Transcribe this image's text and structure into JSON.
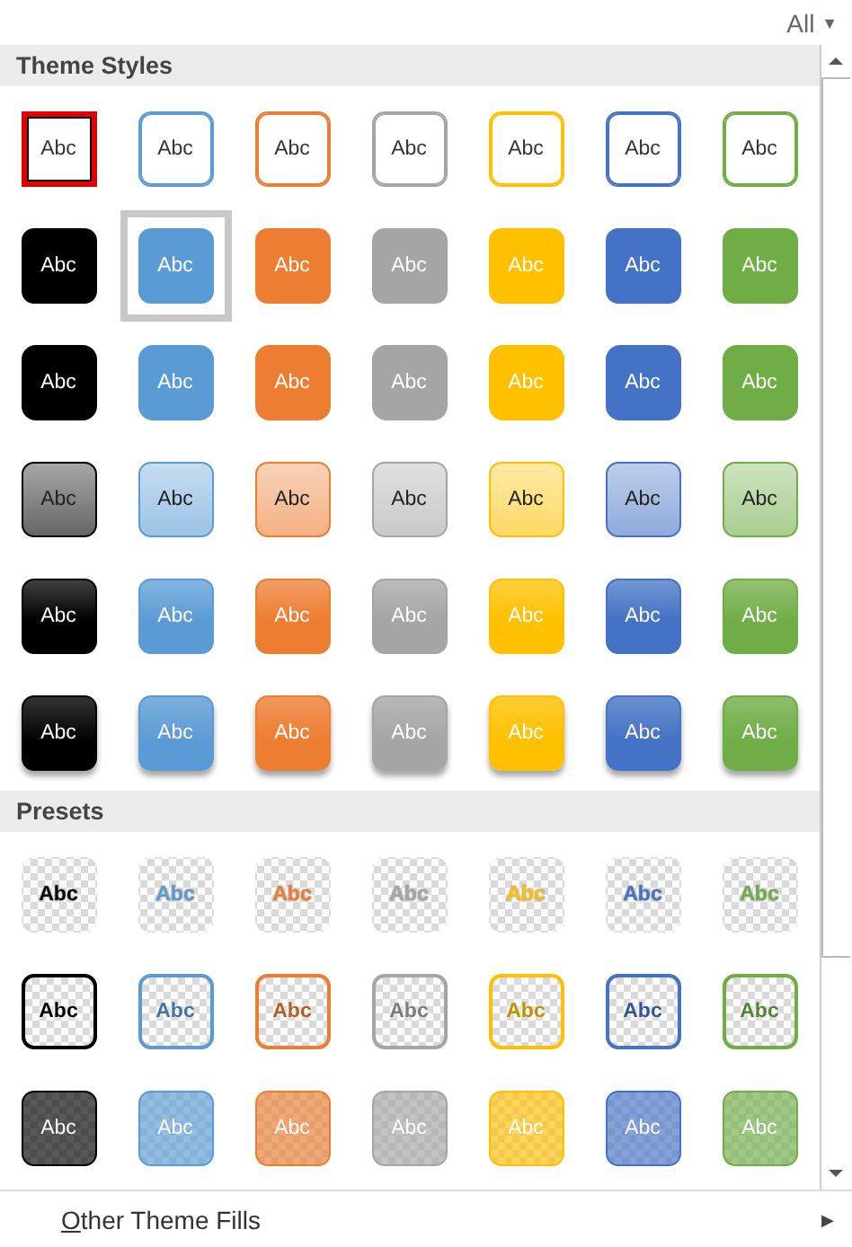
{
  "filter": {
    "label": "All",
    "caret": "▼"
  },
  "sections": [
    {
      "title": "Theme Styles",
      "rows": [
        {
          "kind": "outline",
          "items": [
            {
              "label": "Abc",
              "color": "#000000",
              "selected": true,
              "hovered": false
            },
            {
              "label": "Abc",
              "color": "#5b9bd5",
              "selected": false,
              "hovered": false
            },
            {
              "label": "Abc",
              "color": "#ed7d31",
              "selected": false,
              "hovered": false
            },
            {
              "label": "Abc",
              "color": "#a5a5a5",
              "selected": false,
              "hovered": false
            },
            {
              "label": "Abc",
              "color": "#ffc000",
              "selected": false,
              "hovered": false
            },
            {
              "label": "Abc",
              "color": "#4472c4",
              "selected": false,
              "hovered": false
            },
            {
              "label": "Abc",
              "color": "#70ad47",
              "selected": false,
              "hovered": false
            }
          ]
        },
        {
          "kind": "solid",
          "items": [
            {
              "label": "Abc",
              "color": "#000000",
              "selected": false,
              "hovered": false
            },
            {
              "label": "Abc",
              "color": "#5b9bd5",
              "selected": false,
              "hovered": true
            },
            {
              "label": "Abc",
              "color": "#ed7d31",
              "selected": false,
              "hovered": false
            },
            {
              "label": "Abc",
              "color": "#a5a5a5",
              "selected": false,
              "hovered": false
            },
            {
              "label": "Abc",
              "color": "#ffc000",
              "selected": false,
              "hovered": false
            },
            {
              "label": "Abc",
              "color": "#4472c4",
              "selected": false,
              "hovered": false
            },
            {
              "label": "Abc",
              "color": "#70ad47",
              "selected": false,
              "hovered": false
            }
          ]
        },
        {
          "kind": "plain",
          "items": [
            {
              "label": "Abc",
              "color": "#000000",
              "selected": false,
              "hovered": false
            },
            {
              "label": "Abc",
              "color": "#5b9bd5",
              "selected": false,
              "hovered": false
            },
            {
              "label": "Abc",
              "color": "#ed7d31",
              "selected": false,
              "hovered": false
            },
            {
              "label": "Abc",
              "color": "#a5a5a5",
              "selected": false,
              "hovered": false
            },
            {
              "label": "Abc",
              "color": "#ffc000",
              "selected": false,
              "hovered": false
            },
            {
              "label": "Abc",
              "color": "#4472c4",
              "selected": false,
              "hovered": false
            },
            {
              "label": "Abc",
              "color": "#70ad47",
              "selected": false,
              "hovered": false
            }
          ]
        },
        {
          "kind": "light",
          "items": [
            {
              "label": "Abc",
              "color": "#000000",
              "selected": false,
              "hovered": false
            },
            {
              "label": "Abc",
              "color": "#5b9bd5",
              "selected": false,
              "hovered": false
            },
            {
              "label": "Abc",
              "color": "#ed7d31",
              "selected": false,
              "hovered": false
            },
            {
              "label": "Abc",
              "color": "#a5a5a5",
              "selected": false,
              "hovered": false
            },
            {
              "label": "Abc",
              "color": "#ffc000",
              "selected": false,
              "hovered": false
            },
            {
              "label": "Abc",
              "color": "#4472c4",
              "selected": false,
              "hovered": false
            },
            {
              "label": "Abc",
              "color": "#70ad47",
              "selected": false,
              "hovered": false
            }
          ]
        },
        {
          "kind": "gradient",
          "items": [
            {
              "label": "Abc",
              "color": "#000000",
              "selected": false,
              "hovered": false
            },
            {
              "label": "Abc",
              "color": "#5b9bd5",
              "selected": false,
              "hovered": false
            },
            {
              "label": "Abc",
              "color": "#ed7d31",
              "selected": false,
              "hovered": false
            },
            {
              "label": "Abc",
              "color": "#a5a5a5",
              "selected": false,
              "hovered": false
            },
            {
              "label": "Abc",
              "color": "#ffc000",
              "selected": false,
              "hovered": false
            },
            {
              "label": "Abc",
              "color": "#4472c4",
              "selected": false,
              "hovered": false
            },
            {
              "label": "Abc",
              "color": "#70ad47",
              "selected": false,
              "hovered": false
            }
          ]
        },
        {
          "kind": "shadow",
          "items": [
            {
              "label": "Abc",
              "color": "#000000",
              "selected": false,
              "hovered": false
            },
            {
              "label": "Abc",
              "color": "#5b9bd5",
              "selected": false,
              "hovered": false
            },
            {
              "label": "Abc",
              "color": "#ed7d31",
              "selected": false,
              "hovered": false
            },
            {
              "label": "Abc",
              "color": "#a5a5a5",
              "selected": false,
              "hovered": false
            },
            {
              "label": "Abc",
              "color": "#ffc000",
              "selected": false,
              "hovered": false
            },
            {
              "label": "Abc",
              "color": "#4472c4",
              "selected": false,
              "hovered": false
            },
            {
              "label": "Abc",
              "color": "#70ad47",
              "selected": false,
              "hovered": false
            }
          ]
        }
      ]
    },
    {
      "title": "Presets",
      "rows": [
        {
          "kind": "clear-text",
          "items": [
            {
              "label": "Abc",
              "color": "#000000",
              "selected": false,
              "hovered": false
            },
            {
              "label": "Abc",
              "color": "#5b9bd5",
              "selected": false,
              "hovered": false
            },
            {
              "label": "Abc",
              "color": "#ed7d31",
              "selected": false,
              "hovered": false
            },
            {
              "label": "Abc",
              "color": "#a5a5a5",
              "selected": false,
              "hovered": false
            },
            {
              "label": "Abc",
              "color": "#ffc000",
              "selected": false,
              "hovered": false
            },
            {
              "label": "Abc",
              "color": "#4472c4",
              "selected": false,
              "hovered": false
            },
            {
              "label": "Abc",
              "color": "#70ad47",
              "selected": false,
              "hovered": false
            }
          ]
        },
        {
          "kind": "clear-outline",
          "items": [
            {
              "label": "Abc",
              "color": "#000000",
              "selected": false,
              "hovered": false
            },
            {
              "label": "Abc",
              "color": "#5b9bd5",
              "selected": false,
              "hovered": false
            },
            {
              "label": "Abc",
              "color": "#ed7d31",
              "selected": false,
              "hovered": false
            },
            {
              "label": "Abc",
              "color": "#a5a5a5",
              "selected": false,
              "hovered": false
            },
            {
              "label": "Abc",
              "color": "#ffc000",
              "selected": false,
              "hovered": false
            },
            {
              "label": "Abc",
              "color": "#4472c4",
              "selected": false,
              "hovered": false
            },
            {
              "label": "Abc",
              "color": "#70ad47",
              "selected": false,
              "hovered": false
            }
          ]
        },
        {
          "kind": "clear-fill",
          "items": [
            {
              "label": "Abc",
              "color": "#000000",
              "selected": false,
              "hovered": false
            },
            {
              "label": "Abc",
              "color": "#5b9bd5",
              "selected": false,
              "hovered": false
            },
            {
              "label": "Abc",
              "color": "#ed7d31",
              "selected": false,
              "hovered": false
            },
            {
              "label": "Abc",
              "color": "#a5a5a5",
              "selected": false,
              "hovered": false
            },
            {
              "label": "Abc",
              "color": "#ffc000",
              "selected": false,
              "hovered": false
            },
            {
              "label": "Abc",
              "color": "#4472c4",
              "selected": false,
              "hovered": false
            },
            {
              "label": "Abc",
              "color": "#70ad47",
              "selected": false,
              "hovered": false
            }
          ]
        }
      ]
    }
  ],
  "footer": {
    "label": "Other Theme Fills",
    "arrow": "▶"
  }
}
